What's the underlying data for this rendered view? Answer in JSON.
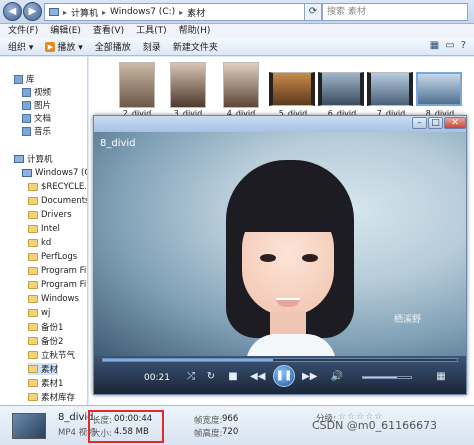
{
  "address": {
    "crumbs": [
      "计算机",
      "Windows7 (C:)",
      "素材"
    ],
    "search_placeholder": "搜索 素材"
  },
  "menu": [
    "文件(F)",
    "编辑(E)",
    "查看(V)",
    "工具(T)",
    "帮助(H)"
  ],
  "toolbar": {
    "organize": "组织 ▾",
    "play": "播放 ▾",
    "play_all": "全部播放",
    "burn": "刻录",
    "new_folder": "新建文件夹"
  },
  "sidebar": {
    "library_header": "库",
    "libraries": [
      "视频",
      "图片",
      "文档",
      "音乐"
    ],
    "computer": "计算机",
    "drive": "Windows7 (C:)",
    "folders": [
      "$RECYCLE.BIN",
      "Documents a",
      "Drivers",
      "Intel",
      "kd",
      "PerfLogs",
      "Program Files",
      "Program Files",
      "Windows",
      "wj",
      "备份1",
      "备份2",
      "立秋节气",
      "素材",
      "素材1",
      "素材库存",
      "素材库存"
    ]
  },
  "thumbnails": [
    "2_divid",
    "3_divid",
    "4_divid",
    "5_divid",
    "6_divid",
    "7_divid",
    "8_divid"
  ],
  "player": {
    "title": "8_divid",
    "watermark": "栖溪野",
    "elapsed": "00:21",
    "progress": 0.48,
    "volume": 0.7
  },
  "details": {
    "name": "8_divid",
    "type": "MP4 视频",
    "length_key": "长度:",
    "length_val": "00:00:44",
    "size_key": "大小:",
    "size_val": "4.58 MB",
    "width_key": "帧宽度:",
    "width_val": "966",
    "height_key": "帧高度:",
    "height_val": "720",
    "rating_key": "分级:",
    "stars": "☆☆☆☆☆"
  },
  "watermark_csdn": "CSDN @m0_61166673"
}
